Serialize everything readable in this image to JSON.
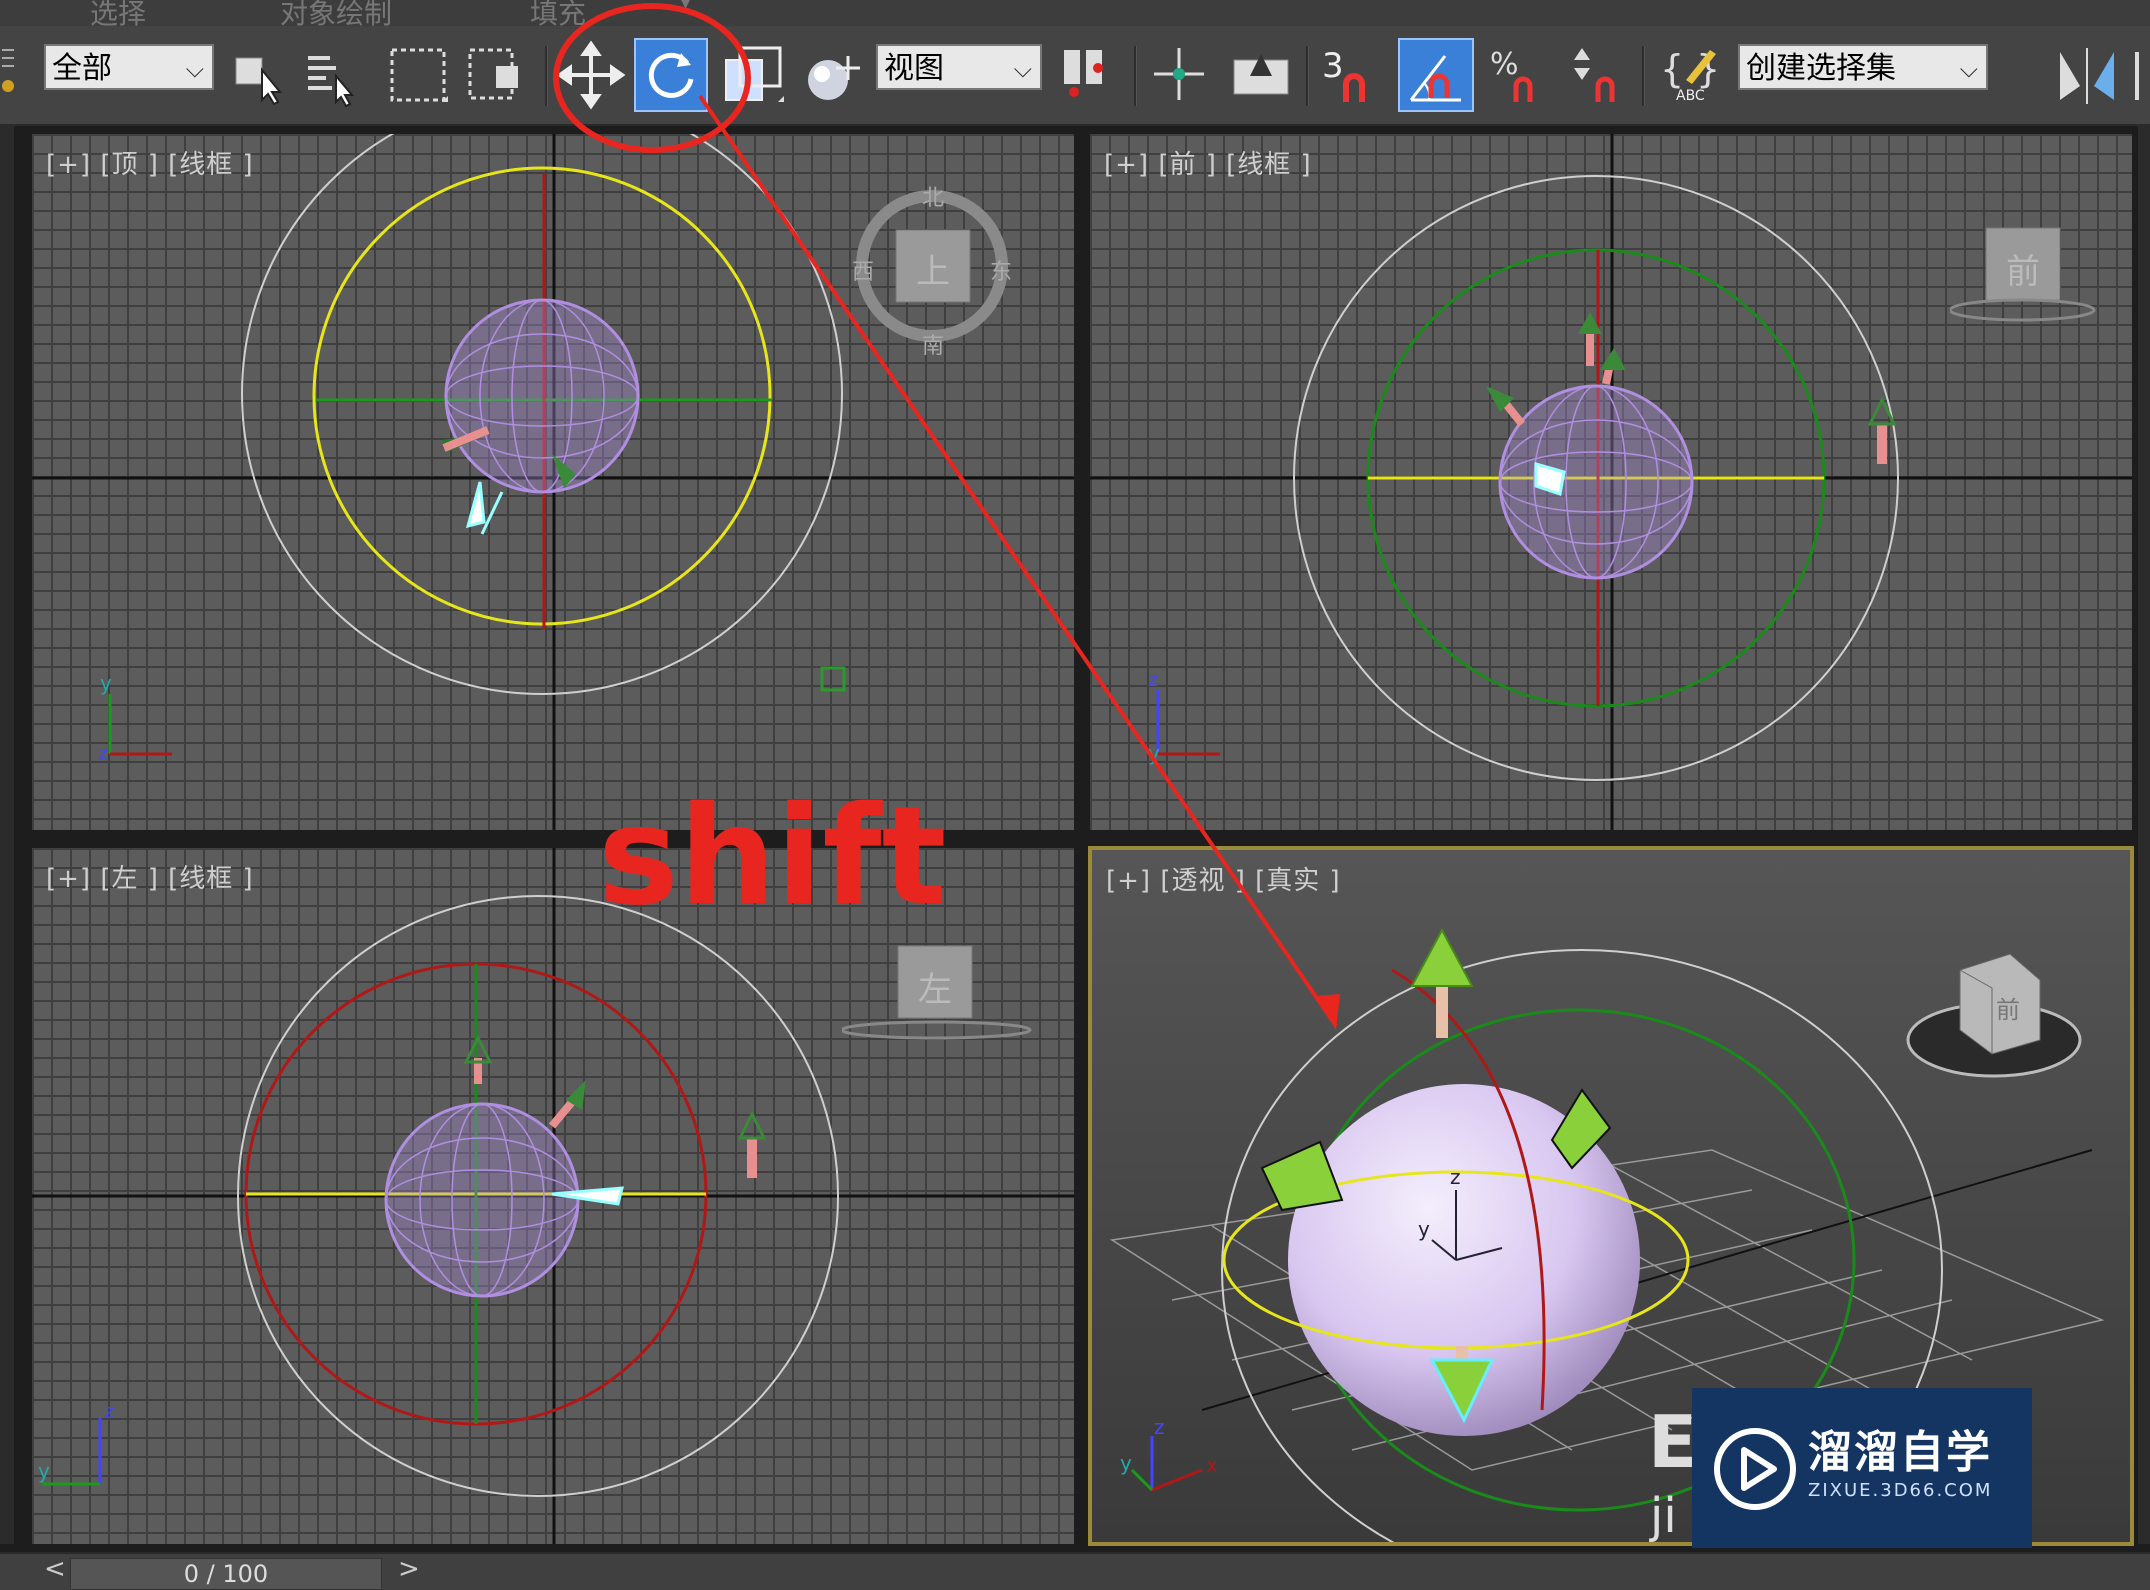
{
  "menu": {
    "items": [
      "选择",
      "对象绘制",
      "填充"
    ]
  },
  "toolbar": {
    "selection_filter": "全部",
    "reference_coord": "视图",
    "snap_toggle_label": "3",
    "named_selection_placeholder": "创建选择集",
    "edit_named_sets_label": "ABC"
  },
  "viewports": {
    "top": {
      "label": "[+] [顶 ] [线框 ]",
      "viewcube_face": "上",
      "compass": {
        "n": "北",
        "s": "南",
        "e": "东",
        "w": "西"
      }
    },
    "front": {
      "label": "[+] [前 ] [线框 ]",
      "viewcube_face": "前"
    },
    "left": {
      "label": "[+] [左 ] [线框 ]",
      "viewcube_face": "左"
    },
    "perspective": {
      "label": "[+] [透视 ] [真实 ]",
      "viewcube_face": "前"
    }
  },
  "axis_labels": {
    "x": "x",
    "y": "y",
    "z": "z"
  },
  "annotation": {
    "text": "shift",
    "color": "#e8261f"
  },
  "timeline": {
    "frame": "0 / 100",
    "prev": "<",
    "next": ">"
  },
  "watermark": {
    "title": "溜溜自学",
    "subtitle": "ZIXUE.3D66.COM",
    "partial": "E",
    "partial2": "ji"
  },
  "colors": {
    "sphere": "#b08ee0",
    "yellow_ring": "#e6e61a",
    "red_axis": "#b01818",
    "green_axis": "#1a8a1a",
    "annotation_red": "#e8261f",
    "active_button": "#3a7fd8"
  }
}
